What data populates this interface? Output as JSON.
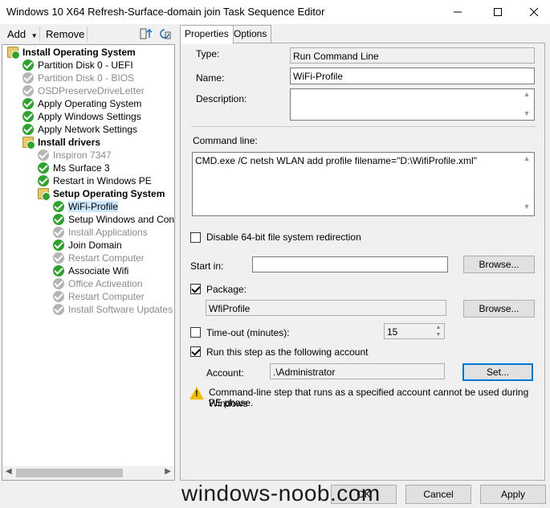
{
  "window": {
    "title": "Windows 10 X64 Refresh-Surface-domain join Task Sequence Editor",
    "minimize_icon": "minimize-icon",
    "maximize_icon": "maximize-icon",
    "close_icon": "close-icon"
  },
  "toolbar": {
    "add_label": "Add",
    "remove_label": "Remove"
  },
  "tree": {
    "items": [
      {
        "label": "Install Operating System",
        "icon": "folder-check-icon",
        "style": "bold"
      },
      {
        "label": "Partition Disk 0 - UEFI",
        "icon": "check-icon",
        "style": "normal"
      },
      {
        "label": "Partition Disk 0 - BIOS",
        "icon": "disabled-check-icon",
        "style": "grey"
      },
      {
        "label": "OSDPreserveDriveLetter",
        "icon": "disabled-check-icon",
        "style": "grey"
      },
      {
        "label": "Apply Operating System",
        "icon": "check-icon",
        "style": "normal"
      },
      {
        "label": "Apply Windows Settings",
        "icon": "check-icon",
        "style": "normal"
      },
      {
        "label": "Apply Network Settings",
        "icon": "check-icon",
        "style": "normal"
      },
      {
        "label": "Install drivers",
        "icon": "folder-check-icon",
        "style": "bold"
      },
      {
        "label": "Inspiron 7347",
        "icon": "disabled-check-icon",
        "style": "grey"
      },
      {
        "label": "Ms Surface 3",
        "icon": "check-icon",
        "style": "normal"
      },
      {
        "label": "Restart in Windows PE",
        "icon": "check-icon",
        "style": "normal"
      },
      {
        "label": "Setup Operating System",
        "icon": "folder-check-icon",
        "style": "bold"
      },
      {
        "label": "WiFi-Profile",
        "icon": "check-icon",
        "style": "selected"
      },
      {
        "label": "Setup Windows and Config",
        "icon": "check-icon",
        "style": "normal"
      },
      {
        "label": "Install Applications",
        "icon": "disabled-check-icon",
        "style": "grey"
      },
      {
        "label": "Join Domain",
        "icon": "check-icon",
        "style": "normal"
      },
      {
        "label": "Restart Computer",
        "icon": "disabled-check-icon",
        "style": "grey"
      },
      {
        "label": "Associate Wifi",
        "icon": "check-icon",
        "style": "normal"
      },
      {
        "label": "Office Activeation",
        "icon": "disabled-check-icon",
        "style": "grey"
      },
      {
        "label": "Restart Computer",
        "icon": "disabled-check-icon",
        "style": "grey"
      },
      {
        "label": "Install Software Updates",
        "icon": "disabled-check-icon",
        "style": "grey"
      }
    ]
  },
  "tabs": [
    {
      "label": "Properties",
      "active": true
    },
    {
      "label": "Options",
      "active": false
    }
  ],
  "properties": {
    "type_label": "Type:",
    "type_value": "Run Command Line",
    "name_label": "Name:",
    "name_value": "WiFi-Profile",
    "description_label": "Description:",
    "description_value": "",
    "command_line_label": "Command line:",
    "command_line_value": "CMD.exe /C netsh WLAN add profile filename=\"D:\\WifiProfile.xml\"",
    "disable_redirection_label": "Disable 64-bit file system redirection",
    "disable_redirection_checked": false,
    "start_in_label": "Start in:",
    "start_in_value": "",
    "browse_label": "Browse...",
    "package_label": "Package:",
    "package_checked": true,
    "package_value": "WfiProfile",
    "timeout_label": "Time-out (minutes):",
    "timeout_checked": false,
    "timeout_value": "15",
    "run_as_label": "Run this step as the following account",
    "run_as_checked": true,
    "account_label": "Account:",
    "account_value": ".\\Administrator",
    "set_label": "Set...",
    "warning_text_1": "Command-line step that runs as a specified account cannot be used during Windows",
    "warning_text_2": "PE phase.",
    "warning_icon": "warning-icon"
  },
  "footer": {
    "ok_label": "OK",
    "cancel_label": "Cancel",
    "apply_label": "Apply"
  },
  "watermark": "windows-noob.com"
}
